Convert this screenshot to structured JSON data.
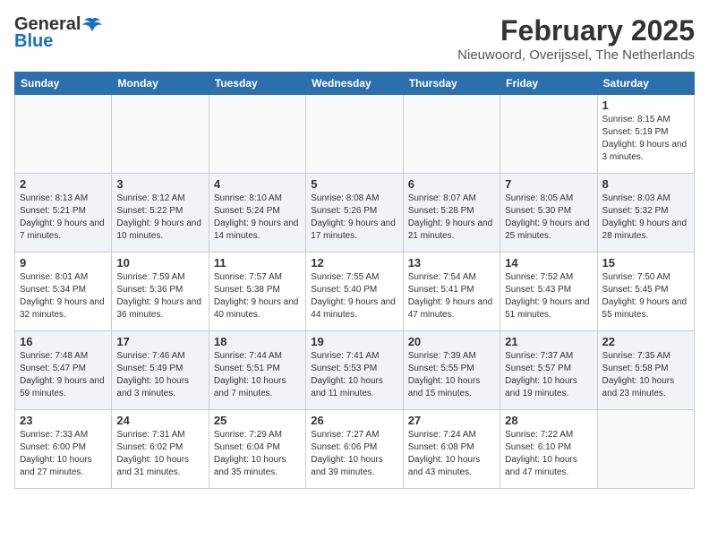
{
  "logo": {
    "general": "General",
    "blue": "Blue"
  },
  "header": {
    "month": "February 2025",
    "location": "Nieuwoord, Overijssel, The Netherlands"
  },
  "weekdays": [
    "Sunday",
    "Monday",
    "Tuesday",
    "Wednesday",
    "Thursday",
    "Friday",
    "Saturday"
  ],
  "weeks": [
    [
      {
        "day": "",
        "info": ""
      },
      {
        "day": "",
        "info": ""
      },
      {
        "day": "",
        "info": ""
      },
      {
        "day": "",
        "info": ""
      },
      {
        "day": "",
        "info": ""
      },
      {
        "day": "",
        "info": ""
      },
      {
        "day": "1",
        "info": "Sunrise: 8:15 AM\nSunset: 5:19 PM\nDaylight: 9 hours and 3 minutes."
      }
    ],
    [
      {
        "day": "2",
        "info": "Sunrise: 8:13 AM\nSunset: 5:21 PM\nDaylight: 9 hours and 7 minutes."
      },
      {
        "day": "3",
        "info": "Sunrise: 8:12 AM\nSunset: 5:22 PM\nDaylight: 9 hours and 10 minutes."
      },
      {
        "day": "4",
        "info": "Sunrise: 8:10 AM\nSunset: 5:24 PM\nDaylight: 9 hours and 14 minutes."
      },
      {
        "day": "5",
        "info": "Sunrise: 8:08 AM\nSunset: 5:26 PM\nDaylight: 9 hours and 17 minutes."
      },
      {
        "day": "6",
        "info": "Sunrise: 8:07 AM\nSunset: 5:28 PM\nDaylight: 9 hours and 21 minutes."
      },
      {
        "day": "7",
        "info": "Sunrise: 8:05 AM\nSunset: 5:30 PM\nDaylight: 9 hours and 25 minutes."
      },
      {
        "day": "8",
        "info": "Sunrise: 8:03 AM\nSunset: 5:32 PM\nDaylight: 9 hours and 28 minutes."
      }
    ],
    [
      {
        "day": "9",
        "info": "Sunrise: 8:01 AM\nSunset: 5:34 PM\nDaylight: 9 hours and 32 minutes."
      },
      {
        "day": "10",
        "info": "Sunrise: 7:59 AM\nSunset: 5:36 PM\nDaylight: 9 hours and 36 minutes."
      },
      {
        "day": "11",
        "info": "Sunrise: 7:57 AM\nSunset: 5:38 PM\nDaylight: 9 hours and 40 minutes."
      },
      {
        "day": "12",
        "info": "Sunrise: 7:55 AM\nSunset: 5:40 PM\nDaylight: 9 hours and 44 minutes."
      },
      {
        "day": "13",
        "info": "Sunrise: 7:54 AM\nSunset: 5:41 PM\nDaylight: 9 hours and 47 minutes."
      },
      {
        "day": "14",
        "info": "Sunrise: 7:52 AM\nSunset: 5:43 PM\nDaylight: 9 hours and 51 minutes."
      },
      {
        "day": "15",
        "info": "Sunrise: 7:50 AM\nSunset: 5:45 PM\nDaylight: 9 hours and 55 minutes."
      }
    ],
    [
      {
        "day": "16",
        "info": "Sunrise: 7:48 AM\nSunset: 5:47 PM\nDaylight: 9 hours and 59 minutes."
      },
      {
        "day": "17",
        "info": "Sunrise: 7:46 AM\nSunset: 5:49 PM\nDaylight: 10 hours and 3 minutes."
      },
      {
        "day": "18",
        "info": "Sunrise: 7:44 AM\nSunset: 5:51 PM\nDaylight: 10 hours and 7 minutes."
      },
      {
        "day": "19",
        "info": "Sunrise: 7:41 AM\nSunset: 5:53 PM\nDaylight: 10 hours and 11 minutes."
      },
      {
        "day": "20",
        "info": "Sunrise: 7:39 AM\nSunset: 5:55 PM\nDaylight: 10 hours and 15 minutes."
      },
      {
        "day": "21",
        "info": "Sunrise: 7:37 AM\nSunset: 5:57 PM\nDaylight: 10 hours and 19 minutes."
      },
      {
        "day": "22",
        "info": "Sunrise: 7:35 AM\nSunset: 5:58 PM\nDaylight: 10 hours and 23 minutes."
      }
    ],
    [
      {
        "day": "23",
        "info": "Sunrise: 7:33 AM\nSunset: 6:00 PM\nDaylight: 10 hours and 27 minutes."
      },
      {
        "day": "24",
        "info": "Sunrise: 7:31 AM\nSunset: 6:02 PM\nDaylight: 10 hours and 31 minutes."
      },
      {
        "day": "25",
        "info": "Sunrise: 7:29 AM\nSunset: 6:04 PM\nDaylight: 10 hours and 35 minutes."
      },
      {
        "day": "26",
        "info": "Sunrise: 7:27 AM\nSunset: 6:06 PM\nDaylight: 10 hours and 39 minutes."
      },
      {
        "day": "27",
        "info": "Sunrise: 7:24 AM\nSunset: 6:08 PM\nDaylight: 10 hours and 43 minutes."
      },
      {
        "day": "28",
        "info": "Sunrise: 7:22 AM\nSunset: 6:10 PM\nDaylight: 10 hours and 47 minutes."
      },
      {
        "day": "",
        "info": ""
      }
    ]
  ]
}
